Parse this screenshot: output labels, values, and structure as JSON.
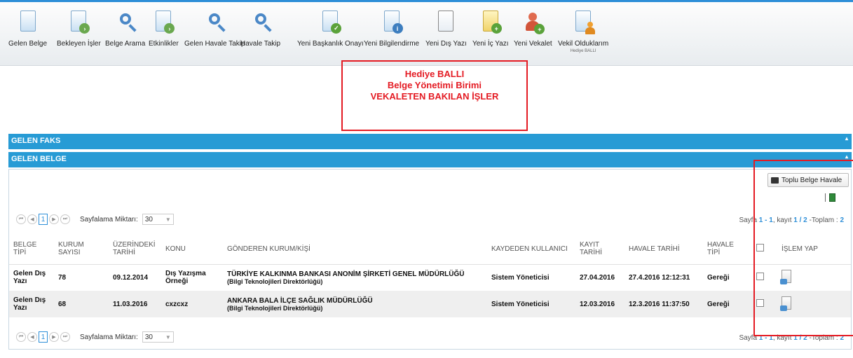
{
  "toolbar": {
    "items": [
      {
        "label": "Gelen Belge",
        "icon": "document-icon"
      },
      {
        "label": "Bekleyen İşler",
        "icon": "document-pending-icon"
      },
      {
        "label": "Belge Arama",
        "icon": "search-icon"
      },
      {
        "label": "Etkinlikler",
        "icon": "document-pending-icon"
      },
      {
        "label": "Gelen Havale Takip",
        "icon": "search-icon"
      },
      {
        "label": "Havale Takip",
        "icon": "search-icon"
      },
      {
        "label": "Yeni Başkanlık Onayı",
        "icon": "document-approve-icon"
      },
      {
        "label": "Yeni Bilgilendirme",
        "icon": "document-info-icon"
      },
      {
        "label": "Yeni Dış Yazı",
        "icon": "document-list-icon"
      },
      {
        "label": "Yeni İç Yazı",
        "icon": "document-add-icon"
      },
      {
        "label": "Yeni Vekalet",
        "icon": "user-add-icon"
      },
      {
        "label": "Vekil Olduklarım",
        "sub": "Hediye BALLI",
        "icon": "document-user-icon"
      }
    ]
  },
  "notice": {
    "line1": "Hediye BALLI",
    "line2": "Belge Yönetimi Birimi",
    "line3": "VEKALETEN BAKILAN İŞLER"
  },
  "panels": {
    "faks": "GELEN FAKS",
    "belge": "GELEN BELGE"
  },
  "actions": {
    "toplu_label": "Toplu Belge Havale"
  },
  "pager": {
    "page": "1",
    "size_label": "Sayfalama Miktarı:",
    "size_value": "30",
    "info_prefix": "Sayfa",
    "info_range": "1 - 1",
    "info_mid": ", kayıt",
    "info_rec": "1 / 2",
    "info_total_label": "-Toplam :",
    "info_total": "2"
  },
  "table": {
    "headers": {
      "belge_tipi": "BELGE TİPİ",
      "kurum_sayisi": "KURUM SAYISI",
      "uzerindeki_tarihi": "ÜZERİNDEKİ TARİHİ",
      "konu": "KONU",
      "gonderen": "GÖNDEREN KURUM/KİŞİ",
      "kaydeden": "KAYDEDEN KULLANICI",
      "kayit_tarihi": "KAYIT TARİHİ",
      "havale_tarihi": "HAVALE TARİHİ",
      "havale_tipi": "HAVALE TİPİ",
      "islem": "İŞLEM YAP"
    },
    "rows": [
      {
        "belge_tipi": "Gelen Dış Yazı",
        "kurum_sayisi": "78",
        "uzerindeki_tarihi": "09.12.2014",
        "konu": "Dış Yazışma Örneği",
        "gonderen": "TÜRKİYE KALKINMA BANKASI ANONİM ŞİRKETİ GENEL MÜDÜRLÜĞÜ",
        "gonderen_sub": "(Bilgi Teknolojileri Direktörlüğü)",
        "kaydeden": "Sistem Yöneticisi",
        "kayit_tarihi": "27.04.2016",
        "havale_tarihi": "27.4.2016 12:12:31",
        "havale_tipi": "Gereği"
      },
      {
        "belge_tipi": "Gelen Dış Yazı",
        "kurum_sayisi": "68",
        "uzerindeki_tarihi": "11.03.2016",
        "konu": "cxzcxz",
        "gonderen": "ANKARA BALA İLÇE SAĞLIK MÜDÜRLÜĞÜ",
        "gonderen_sub": "(Bilgi Teknolojileri Direktörlüğü)",
        "kaydeden": "Sistem Yöneticisi",
        "kayit_tarihi": "12.03.2016",
        "havale_tarihi": "12.3.2016 11:37:50",
        "havale_tipi": "Gereği"
      }
    ]
  }
}
